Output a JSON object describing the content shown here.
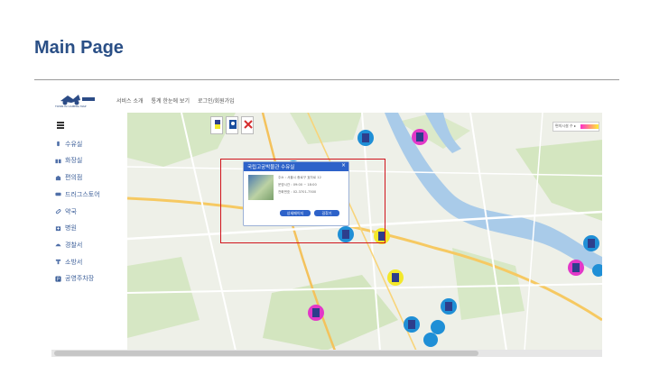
{
  "slide": {
    "title": "Main Page"
  },
  "header": {
    "logo_text": "TOWN IN CAMERA MAP",
    "nav": [
      "서비스 소개",
      "통계 한눈에 보기",
      "로그인/회원가입"
    ]
  },
  "sidebar": {
    "items": [
      {
        "label": "수유실",
        "icon": "bottle-icon",
        "color": "#4f6fa8"
      },
      {
        "label": "화장실",
        "icon": "restroom-icon",
        "color": "#4f6fa8"
      },
      {
        "label": "편의점",
        "icon": "store-icon",
        "color": "#4f6fa8"
      },
      {
        "label": "드러그스토어",
        "icon": "drugstore-icon",
        "color": "#4f6fa8"
      },
      {
        "label": "약국",
        "icon": "pill-icon",
        "color": "#4f6fa8"
      },
      {
        "label": "병원",
        "icon": "hospital-icon",
        "color": "#4f6fa8"
      },
      {
        "label": "경찰서",
        "icon": "police-icon",
        "color": "#4f6fa8"
      },
      {
        "label": "소방서",
        "icon": "fire-station-icon",
        "color": "#4f6fa8"
      },
      {
        "label": "공영주차장",
        "icon": "parking-icon",
        "color": "#4f6fa8"
      }
    ]
  },
  "map": {
    "legend": [
      "category-filter-icons"
    ],
    "popup": {
      "title": "국립고궁박물관 수유실",
      "lines": [
        "주소 : 서울시 종로구 효자로 12",
        "운영시간 : 09:00 ~ 18:00",
        "전화번호 : 02-3701-7500"
      ],
      "buttons": [
        "상세페이지",
        "길찾기"
      ]
    },
    "colors": {
      "highlight": "#d0141c",
      "popup_header": "#2d62c9",
      "marker_blue": "#1f8fd6",
      "marker_magenta": "#e238c8",
      "marker_yellow": "#f3e82a"
    }
  }
}
